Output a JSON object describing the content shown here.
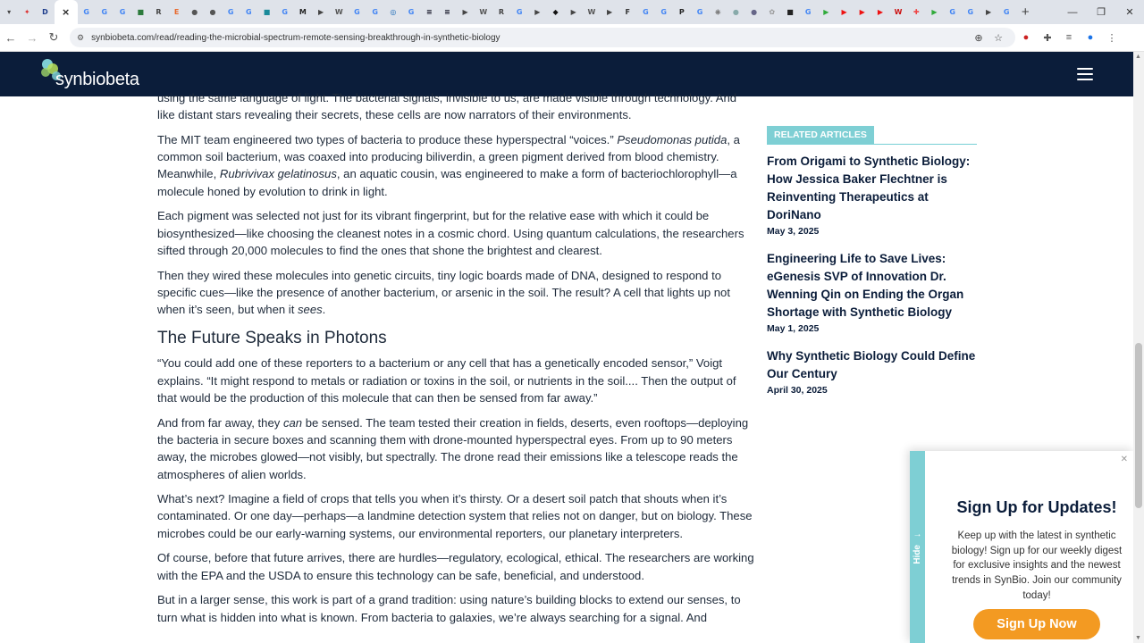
{
  "browser": {
    "tab_favicons": [
      {
        "glyph": "▾",
        "color": "#dfe3ea"
      },
      {
        "glyph": "✦",
        "color": "#d33"
      },
      {
        "glyph": "D",
        "color": "#1a3a8a"
      },
      {
        "glyph": "×",
        "color": "#ffffff"
      },
      {
        "glyph": "G",
        "color": "#4285f4"
      },
      {
        "glyph": "G",
        "color": "#4285f4"
      },
      {
        "glyph": "G",
        "color": "#4285f4"
      },
      {
        "glyph": "■",
        "color": "#2b7a3b"
      },
      {
        "glyph": "R",
        "color": "#444"
      },
      {
        "glyph": "E",
        "color": "#e8672a"
      },
      {
        "glyph": "●",
        "color": "#555"
      },
      {
        "glyph": "●",
        "color": "#555"
      },
      {
        "glyph": "G",
        "color": "#4285f4"
      },
      {
        "glyph": "G",
        "color": "#4285f4"
      },
      {
        "glyph": "■",
        "color": "#1a8a9a"
      },
      {
        "glyph": "G",
        "color": "#4285f4"
      },
      {
        "glyph": "M",
        "color": "#222"
      },
      {
        "glyph": "▶",
        "color": "#444"
      },
      {
        "glyph": "W",
        "color": "#555"
      },
      {
        "glyph": "G",
        "color": "#4285f4"
      },
      {
        "glyph": "G",
        "color": "#4285f4"
      },
      {
        "glyph": "◎",
        "color": "#1a6ab8"
      },
      {
        "glyph": "G",
        "color": "#4285f4"
      },
      {
        "glyph": "≡",
        "color": "#223"
      },
      {
        "glyph": "≡",
        "color": "#223"
      },
      {
        "glyph": "▶",
        "color": "#444"
      },
      {
        "glyph": "W",
        "color": "#555"
      },
      {
        "glyph": "R",
        "color": "#444"
      },
      {
        "glyph": "G",
        "color": "#4285f4"
      },
      {
        "glyph": "▶",
        "color": "#444"
      },
      {
        "glyph": "◆",
        "color": "#111"
      },
      {
        "glyph": "▶",
        "color": "#444"
      },
      {
        "glyph": "W",
        "color": "#555"
      },
      {
        "glyph": "▶",
        "color": "#444"
      },
      {
        "glyph": "F",
        "color": "#333"
      },
      {
        "glyph": "G",
        "color": "#4285f4"
      },
      {
        "glyph": "G",
        "color": "#4285f4"
      },
      {
        "glyph": "P",
        "color": "#222"
      },
      {
        "glyph": "G",
        "color": "#4285f4"
      },
      {
        "glyph": "⎈",
        "color": "#777"
      },
      {
        "glyph": "●",
        "color": "#8aa"
      },
      {
        "glyph": "●",
        "color": "#668"
      },
      {
        "glyph": "✿",
        "color": "#999"
      },
      {
        "glyph": "■",
        "color": "#222"
      },
      {
        "glyph": "G",
        "color": "#4285f4"
      },
      {
        "glyph": "▶",
        "color": "#2faa3a"
      },
      {
        "glyph": "▶",
        "color": "#e11"
      },
      {
        "glyph": "▶",
        "color": "#e11"
      },
      {
        "glyph": "▶",
        "color": "#e11"
      },
      {
        "glyph": "W",
        "color": "#c11"
      },
      {
        "glyph": "✚",
        "color": "#e44"
      },
      {
        "glyph": "▶",
        "color": "#2faa3a"
      },
      {
        "glyph": "G",
        "color": "#4285f4"
      },
      {
        "glyph": "G",
        "color": "#4285f4"
      },
      {
        "glyph": "▶",
        "color": "#444"
      },
      {
        "glyph": "G",
        "color": "#4285f4"
      }
    ],
    "url": "synbiobeta.com/read/reading-the-microbial-spectrum-remote-sensing-breakthrough-in-synthetic-biology"
  },
  "header": {
    "logo_text": "synbiobeta"
  },
  "article": {
    "p0": "using the same language of light. The bacterial signals, invisible to us, are made visible through technology. And like distant stars revealing their secrets, these cells are now narrators of their environments.",
    "p1_a": "The MIT team engineered two types of bacteria to produce these hyperspectral “voices.” ",
    "p1_em1": "Pseudomonas putida",
    "p1_b": ", a common soil bacterium, was coaxed into producing biliverdin, a green pigment derived from blood chemistry. Meanwhile, ",
    "p1_em2": "Rubrivivax gelatinosus",
    "p1_c": ", an aquatic cousin, was engineered to make a form of bacteriochlorophyll—a molecule honed by evolution to drink in light.",
    "p2": "Each pigment was selected not just for its vibrant fingerprint, but for the relative ease with which it could be biosynthesized—like choosing the cleanest notes in a cosmic chord. Using quantum calculations, the researchers sifted through 20,000 molecules to find the ones that shone the brightest and clearest.",
    "p3_a": "Then they wired these molecules into genetic circuits, tiny logic boards made of DNA, designed to respond to specific cues—like the presence of another bacterium, or arsenic in the soil. The result? A cell that lights up not when it’s seen, but when it ",
    "p3_em": "sees",
    "p3_b": ".",
    "h2": "The Future Speaks in Photons",
    "p4": "“You could add one of these reporters to a bacterium or any cell that has a genetically encoded sensor,” Voigt explains. “It might respond to metals or radiation or toxins in the soil, or nutrients in the soil.... Then the output of that would be the production of this molecule that can then be sensed from far away.”",
    "p5_a": "And from far away, they ",
    "p5_em": "can",
    "p5_b": " be sensed. The team tested their creation in fields, deserts, even rooftops—deploying the bacteria in secure boxes and scanning them with drone-mounted hyperspectral eyes. From up to 90 meters away, the microbes glowed—not visibly, but spectrally. The drone read their emissions like a telescope reads the atmospheres of alien worlds.",
    "p6": "What’s next? Imagine a field of crops that tells you when it’s thirsty. Or a desert soil patch that shouts when it’s contaminated. Or one day—perhaps—a landmine detection system that relies not on danger, but on biology. These microbes could be our early-warning systems, our environmental reporters, our planetary interpreters.",
    "p7": "Of course, before that future arrives, there are hurdles—regulatory, ecological, ethical. The researchers are working with the EPA and the USDA to ensure this technology can be safe, beneficial, and understood.",
    "p8": "But in a larger sense, this work is part of a grand tradition: using nature’s building blocks to extend our senses, to turn what is hidden into what is known. From bacteria to galaxies, we’re always searching for a signal. And"
  },
  "related": {
    "heading": "RELATED ARTICLES",
    "items": [
      {
        "title": "From Origami to Synthetic Biology: How Jessica Baker Flechtner is Reinventing Therapeutics at DoriNano",
        "date": "May 3, 2025"
      },
      {
        "title": "Engineering Life to Save Lives: eGenesis SVP of Innovation Dr. Wenning Qin on Ending the Organ Shortage with Synthetic Biology",
        "date": "May 1, 2025"
      },
      {
        "title": "Why Synthetic Biology Could Define Our Century",
        "date": "April 30, 2025"
      }
    ]
  },
  "popup": {
    "hide_label": "Hide",
    "title": "Sign Up for Updates!",
    "description": "Keep up with the latest in synthetic biology! Sign up for our weekly digest for exclusive insights and the newest trends in SynBio. Join our community today!",
    "button": "Sign Up Now"
  },
  "colors": {
    "header_bg": "#0b1d3a",
    "accent_teal": "#7ecfd4",
    "cta_orange": "#f39a22"
  }
}
